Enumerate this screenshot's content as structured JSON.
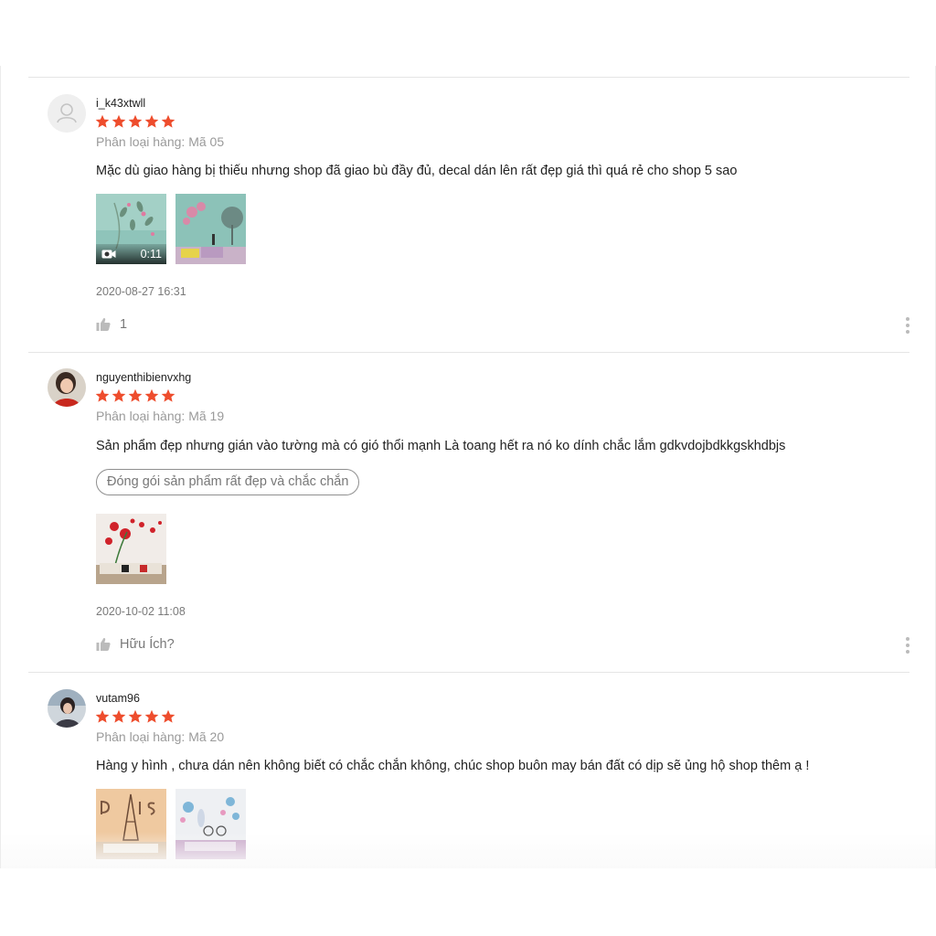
{
  "colors": {
    "star": "#ee4d2d",
    "divider": "#e5e5e5",
    "muted": "#9a9a9a"
  },
  "reviews": [
    {
      "username": "i_k43xtwll",
      "rating": 5,
      "variant": "Phân loại hàng: Mã 05",
      "comment": "Mặc dù giao hàng bị thiếu nhưng shop đã giao bù đầy đủ, decal dán lên rất đẹp giá thì quá rẻ cho shop 5 sao",
      "video_duration": "0:11",
      "date": "2020-08-27 16:31",
      "like_text": "1"
    },
    {
      "username": "nguyenthibienvxhg",
      "rating": 5,
      "variant": "Phân loại hàng: Mã 19",
      "comment": "Sản phẩm đẹp nhưng gián vào tường mà có gió thổi mạnh Là toang hết ra nó ko dính chắc lắm gdkvdojbdkkgskhdbjs",
      "tag": "Đóng gói sản phẩm rất đẹp và chắc chắn",
      "date": "2020-10-02 11:08",
      "like_text": "Hữu Ích?"
    },
    {
      "username": "vutam96",
      "rating": 5,
      "variant": "Phân loại hàng: Mã 20",
      "comment": "Hàng y hình , chưa dán nên không biết có chắc chắn không, chúc shop buôn may bán đất có dịp sẽ ủng hộ shop thêm ạ !"
    }
  ]
}
